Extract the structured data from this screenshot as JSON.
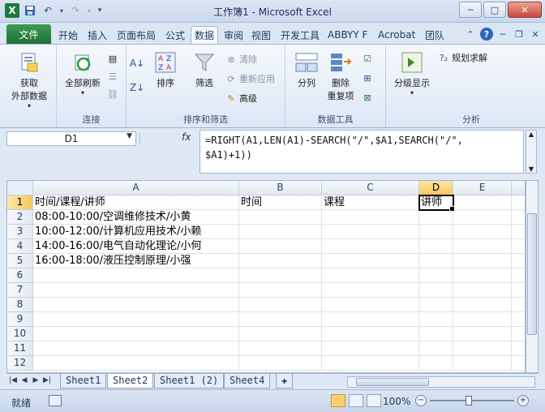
{
  "window": {
    "title": "工作簿1 - Microsoft Excel",
    "app_icon_letter": "X"
  },
  "ribbon": {
    "file_tab": "文件",
    "tabs": [
      "开始",
      "插入",
      "页面布局",
      "公式",
      "数据",
      "审阅",
      "视图",
      "开发工具",
      "ABBYY F",
      "Acrobat",
      "团队"
    ],
    "active_tab": "数据",
    "groups": {
      "get_external": {
        "label": "",
        "button": "获取\n外部数据"
      },
      "connections": {
        "label": "连接",
        "refresh_all": "全部刷新"
      },
      "sort_filter": {
        "label": "排序和筛选",
        "sort": "排序",
        "filter": "筛选",
        "clear": "清除",
        "reapply": "重新应用",
        "advanced": "高级"
      },
      "data_tools": {
        "label": "数据工具",
        "split": "分列",
        "remove_dup": "删除\n重复项"
      },
      "outline": {
        "label": "分析",
        "group_show": "分级显示"
      },
      "solver": "规划求解"
    }
  },
  "formula_bar": {
    "name_box": "D1",
    "fx": "fx",
    "formula": "=RIGHT(A1,LEN(A1)-SEARCH(\"/\",$A1,SEARCH(\"/\",\n$A1)+1))"
  },
  "sheet": {
    "columns": [
      "A",
      "B",
      "C",
      "D",
      "E"
    ],
    "selected_column": "D",
    "selected_row": 1,
    "rows": [
      [
        "时间/课程/讲师",
        "时间",
        "课程",
        "讲师",
        ""
      ],
      [
        "08:00-10:00/空调维修技术/小黄",
        "",
        "",
        "",
        ""
      ],
      [
        "10:00-12:00/计算机应用技术/小赖",
        "",
        "",
        "",
        ""
      ],
      [
        "14:00-16:00/电气自动化理论/小何",
        "",
        "",
        "",
        ""
      ],
      [
        "16:00-18:00/液压控制原理/小强",
        "",
        "",
        "",
        ""
      ],
      [
        "",
        "",
        "",
        "",
        ""
      ],
      [
        "",
        "",
        "",
        "",
        ""
      ],
      [
        "",
        "",
        "",
        "",
        ""
      ],
      [
        "",
        "",
        "",
        "",
        ""
      ],
      [
        "",
        "",
        "",
        "",
        ""
      ],
      [
        "",
        "",
        "",
        "",
        ""
      ],
      [
        "",
        "",
        "",
        "",
        ""
      ]
    ],
    "row_numbers": [
      "1",
      "2",
      "3",
      "4",
      "5",
      "6",
      "7",
      "8",
      "9",
      "10",
      "11",
      "12"
    ]
  },
  "sheet_tabs": [
    "Sheet1",
    "Sheet2",
    "Sheet1 (2)",
    "Sheet4"
  ],
  "active_sheet": "Sheet2",
  "status": {
    "mode": "就绪",
    "zoom": "100%"
  }
}
